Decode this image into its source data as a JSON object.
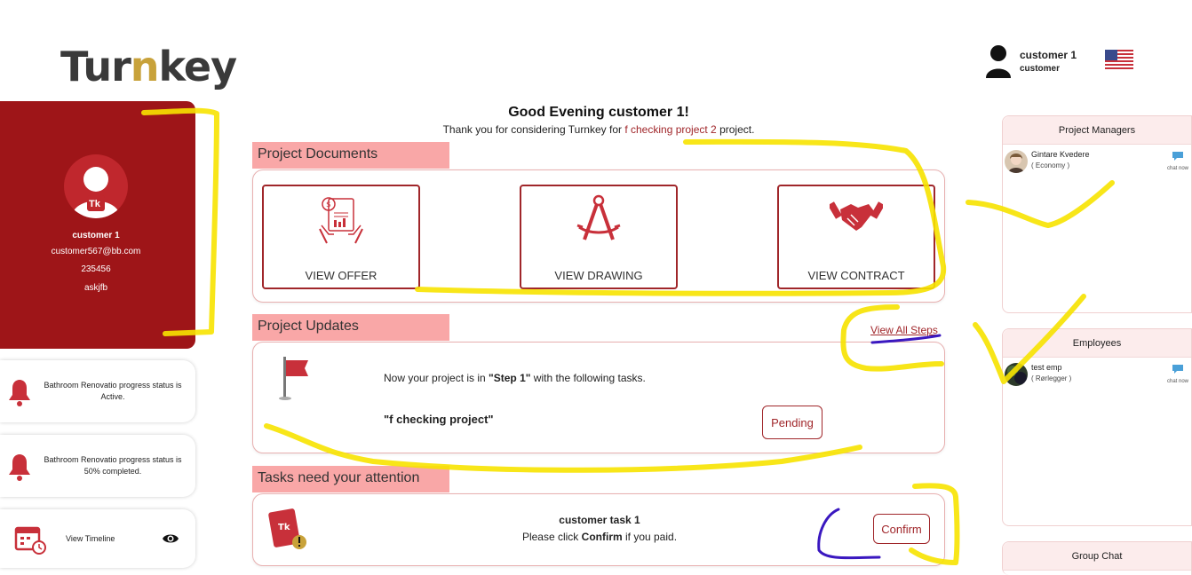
{
  "brand": {
    "logo_text_a": "Tur",
    "logo_text_b": "n",
    "logo_text_c": "key"
  },
  "user": {
    "name": "customer 1",
    "role": "customer",
    "flag": "us-flag-icon"
  },
  "profile": {
    "name": "customer 1",
    "email": "customer567@bb.com",
    "phone": "235456",
    "extra": "askjfb",
    "badge": "Tk"
  },
  "notifications": [
    {
      "text": "Bathroom Renovatio progress status is Active."
    },
    {
      "text": "Bathroom Renovatio progress status is 50% completed."
    }
  ],
  "timeline": {
    "label": "View Timeline"
  },
  "greeting": {
    "title": "Good Evening customer 1!",
    "sub_before": "Thank you for considering Turnkey for ",
    "project_name": "f checking project 2",
    "sub_after": " project."
  },
  "documents": {
    "heading": "Project Documents",
    "items": [
      {
        "label": "VIEW OFFER"
      },
      {
        "label": "VIEW DRAWING"
      },
      {
        "label": "VIEW CONTRACT"
      }
    ]
  },
  "updates": {
    "heading": "Project Updates",
    "view_all": "View All Steps",
    "text_before": "Now your project is in ",
    "step": "\"Step 1\"",
    "text_after": " with the following tasks.",
    "task_name": "\"f checking project\"",
    "status": "Pending"
  },
  "tasks": {
    "heading": "Tasks need your attention",
    "title": "customer task 1",
    "desc_before": "Please click ",
    "desc_bold": "Confirm",
    "desc_after": " if you paid.",
    "confirm": "Confirm"
  },
  "project_managers": {
    "heading": "Project Managers",
    "people": [
      {
        "name": "Gintare Kvedere",
        "sub": "( Economy )",
        "chat": "chat now"
      }
    ]
  },
  "employees": {
    "heading": "Employees",
    "people": [
      {
        "name": "test emp",
        "sub": "( Rørlegger )",
        "chat": "chat now"
      }
    ]
  },
  "group_chat": {
    "heading": "Group Chat"
  },
  "colors": {
    "brand_red": "#9e1518",
    "accent_red": "#a0262a",
    "tab_pink": "#f9a7a7"
  }
}
